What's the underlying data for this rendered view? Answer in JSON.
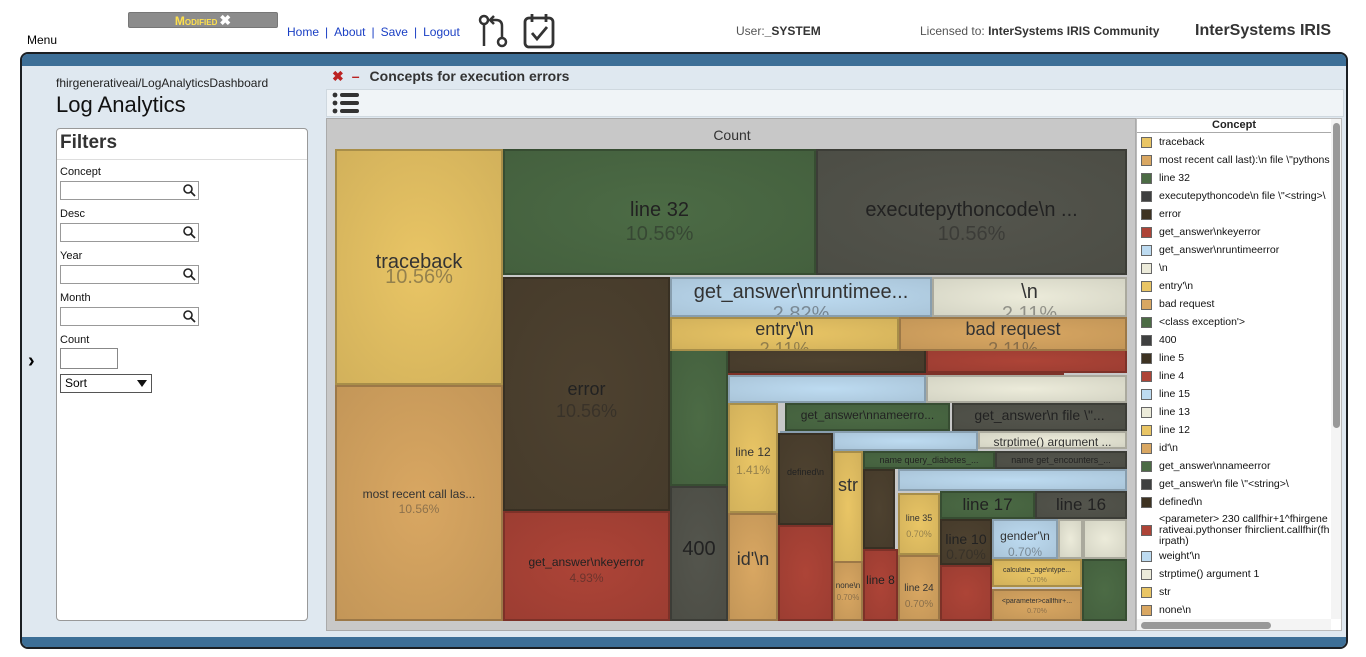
{
  "header": {
    "menu_label": "Menu",
    "modified_label": "Modified",
    "nav": [
      "Home",
      "About",
      "Save",
      "Logout"
    ],
    "user_label": "User:",
    "user_value": "_SYSTEM",
    "license_label": "Licensed to:",
    "license_value": "InterSystems IRIS Community",
    "brand": "InterSystems IRIS",
    "icons": [
      "source-control-icon",
      "task-checklist-icon",
      "close-icon"
    ]
  },
  "dashboard": {
    "path": "fhirgenerativeai/LogAnalyticsDashboard",
    "title": "Log Analytics"
  },
  "filters": {
    "title": "Filters",
    "fields": [
      {
        "label": "Concept",
        "value": ""
      },
      {
        "label": "Desc",
        "value": ""
      },
      {
        "label": "Year",
        "value": ""
      },
      {
        "label": "Month",
        "value": ""
      }
    ],
    "count_label": "Count",
    "count_value": "",
    "sort_value": "Sort"
  },
  "panel": {
    "title": "Concepts for execution errors",
    "chart_title": "Count"
  },
  "colors": {
    "gold": "#e9c565",
    "tan": "#d9a762",
    "green": "#4c6b45",
    "darkgray": "#54554d",
    "darkbrown": "#4e4230",
    "red": "#ad4437",
    "lightblue": "#bddbf1",
    "cream": "#ecebda",
    "frame": "#3d6f97"
  },
  "chart_data": {
    "type": "treemap",
    "value_label": "Count",
    "tiles": [
      {
        "label": "traceback",
        "pct": "10.56%"
      },
      {
        "label": "most recent call las...",
        "pct": "10.56%"
      },
      {
        "label": "line 32",
        "pct": "10.56%"
      },
      {
        "label": "executepythoncode\\n ...",
        "pct": "10.56%"
      },
      {
        "label": "error",
        "pct": "10.56%"
      },
      {
        "label": "get_answer\\nkeyerror",
        "pct": "4.93%"
      },
      {
        "label": "get_answer\\nruntimee...",
        "pct": "2.82%"
      },
      {
        "label": "\\n",
        "pct": "2.11%"
      },
      {
        "label": "entry'\\n",
        "pct": "2.11%"
      },
      {
        "label": "bad request",
        "pct": "2.11%"
      },
      {
        "label": "400",
        "pct": ""
      },
      {
        "label": "line 12",
        "pct": "1.41%"
      },
      {
        "label": "get_answer\\nnameerro...",
        "pct": "1.41%"
      },
      {
        "label": "get_answer\\n file \\\"...",
        "pct": ""
      },
      {
        "label": "strptime() argument ...",
        "pct": ""
      },
      {
        "label": "defined\\n",
        "pct": ""
      },
      {
        "label": "str",
        "pct": ""
      },
      {
        "label": "name query_diabetes_...",
        "pct": ""
      },
      {
        "label": "name get_encounters_...",
        "pct": ""
      },
      {
        "label": "line 17",
        "pct": ""
      },
      {
        "label": "line 16",
        "pct": ""
      },
      {
        "label": "line 35",
        "pct": "0.70%"
      },
      {
        "label": "line 10",
        "pct": "0.70%"
      },
      {
        "label": "gender'\\n",
        "pct": "0.70%"
      },
      {
        "label": "id'\\n",
        "pct": ""
      },
      {
        "label": "none\\n",
        "pct": "0.70%"
      },
      {
        "label": "line 8",
        "pct": ""
      },
      {
        "label": "line 24",
        "pct": "0.70%"
      },
      {
        "label": "calculate_age\\ntype...",
        "pct": "0.70%"
      },
      {
        "label": "<parameter>callfhir+...",
        "pct": "0.70%"
      }
    ]
  },
  "legend": {
    "header": "Concept",
    "items": [
      {
        "label": "traceback",
        "color": "#e9c565"
      },
      {
        "label": "most recent call last):\\n file \\\"pythons",
        "color": "#d9a762"
      },
      {
        "label": "line 32",
        "color": "#4c6b45"
      },
      {
        "label": "executepythoncode\\n file \\\"<string>\\",
        "color": "#3f4040"
      },
      {
        "label": "error",
        "color": "#3e3322"
      },
      {
        "label": "get_answer\\nkeyerror",
        "color": "#ad4437"
      },
      {
        "label": "get_answer\\nruntimeerror",
        "color": "#bddbf1"
      },
      {
        "label": "\\n",
        "color": "#ecebda"
      },
      {
        "label": "entry'\\n",
        "color": "#e9c565"
      },
      {
        "label": "bad request",
        "color": "#d9a762"
      },
      {
        "label": "<class exception'>",
        "color": "#4c6b45"
      },
      {
        "label": "400",
        "color": "#3f4040"
      },
      {
        "label": "line 5",
        "color": "#3e3322"
      },
      {
        "label": "line 4",
        "color": "#ad4437"
      },
      {
        "label": "line 15",
        "color": "#bddbf1"
      },
      {
        "label": "line 13",
        "color": "#ecebda"
      },
      {
        "label": "line 12",
        "color": "#e9c565"
      },
      {
        "label": "id'\\n",
        "color": "#d9a762"
      },
      {
        "label": "get_answer\\nnameerror",
        "color": "#4c6b45"
      },
      {
        "label": "get_answer\\n file \\\"<string>\\",
        "color": "#3f4040"
      },
      {
        "label": "defined\\n",
        "color": "#3e3322"
      },
      {
        "label": "<parameter> 230 callfhir+1^fhirgenerativeai.pythonser fhirclient.callfhir(fhirpath)",
        "color": "#ad4437"
      },
      {
        "label": "weight'\\n",
        "color": "#bddbf1"
      },
      {
        "label": "strptime() argument 1",
        "color": "#ecebda"
      },
      {
        "label": "str",
        "color": "#e9c565"
      },
      {
        "label": "none\\n",
        "color": "#d9a762"
      }
    ]
  }
}
